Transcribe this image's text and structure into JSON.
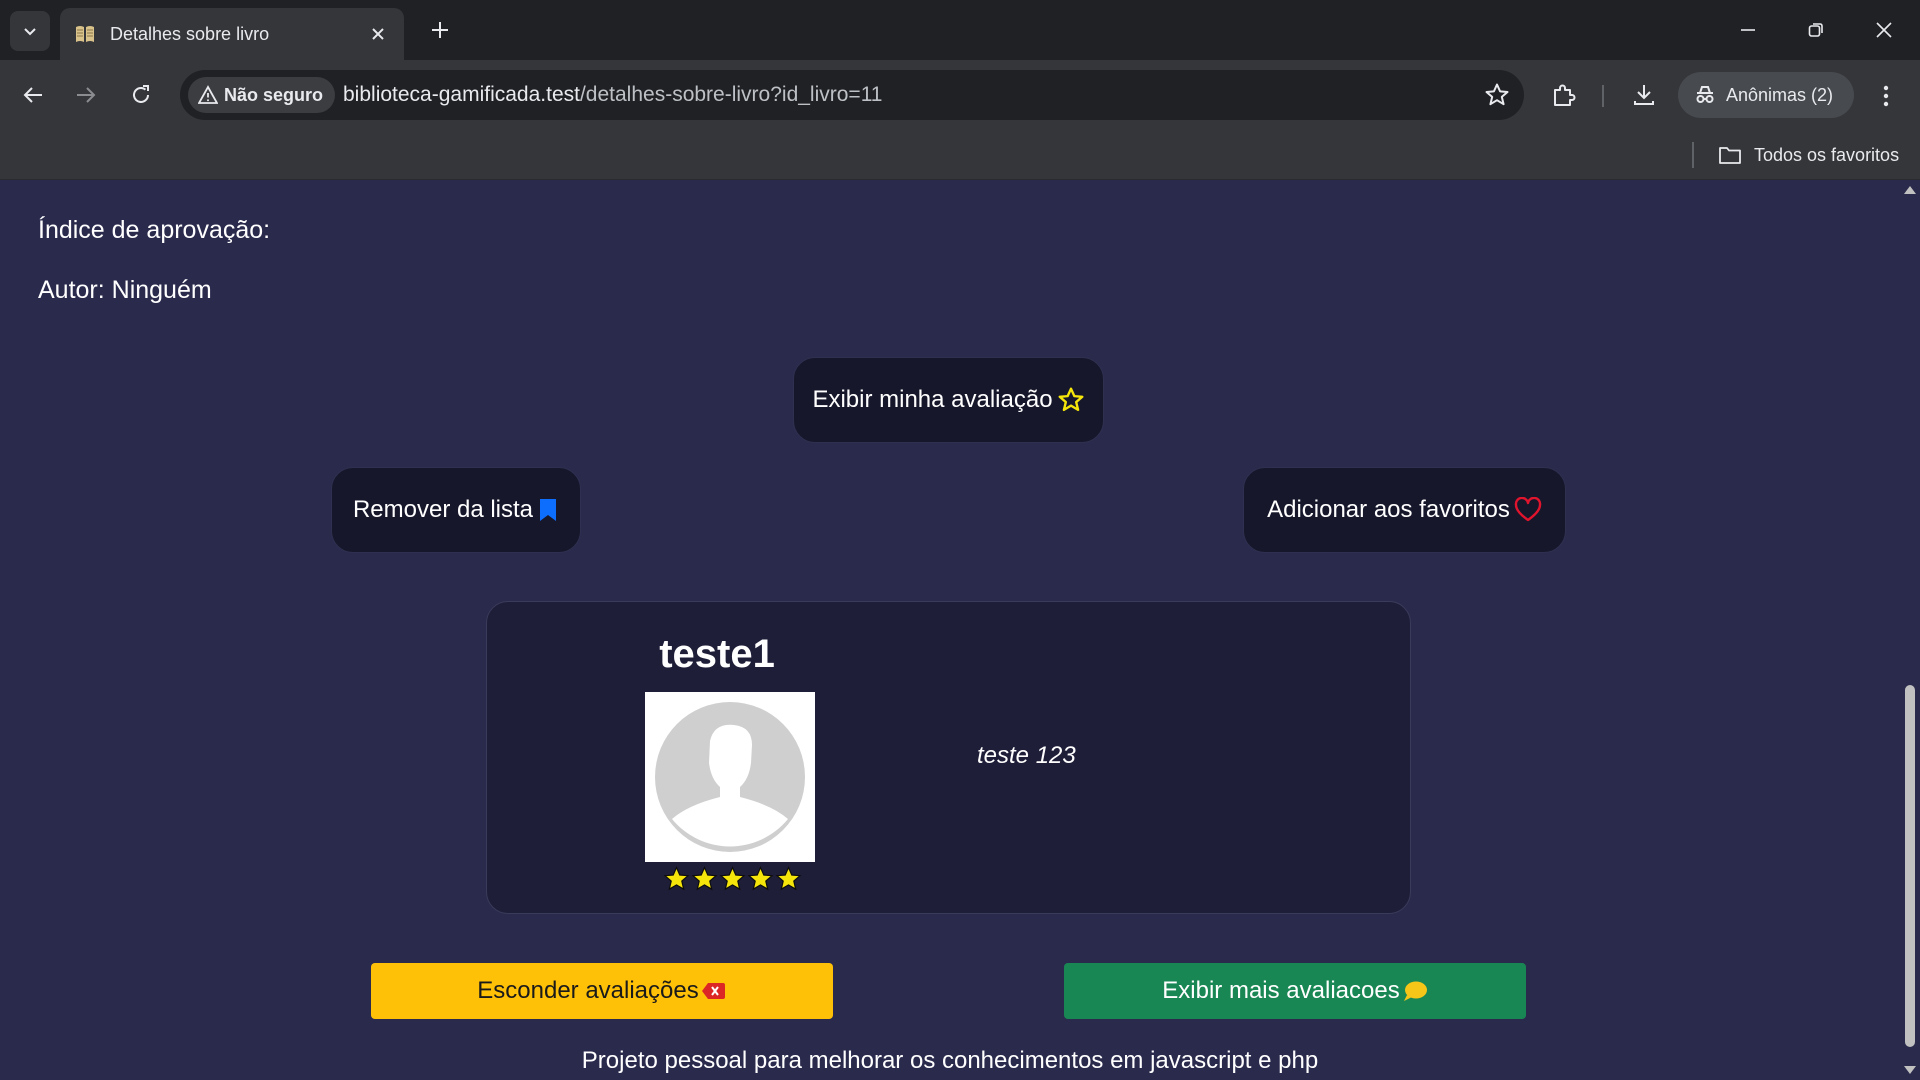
{
  "browser": {
    "tab_title": "Detalhes sobre livro",
    "security_label": "Não seguro",
    "url_host": "biblioteca-gamificada.test",
    "url_path": "/detalhes-sobre-livro?id_livro=11",
    "profile_label": "Anônimas (2)",
    "bookmarks_all_label": "Todos os favoritos"
  },
  "book": {
    "approval_label": "Índice de aprovação:",
    "author_label": "Autor: Ninguém"
  },
  "actions": {
    "show_my_review": "Exibir minha avaliação",
    "remove_from_list": "Remover da lista",
    "add_to_favorites": "Adicionar aos favoritos"
  },
  "review": {
    "username": "teste1",
    "text": "teste 123",
    "stars": 5,
    "max_stars": 5
  },
  "buttons": {
    "hide_reviews": "Esconder avaliações",
    "show_more_reviews": "Exibir mais avaliacoes"
  },
  "footer": {
    "text": "Projeto pessoal para melhorar os conhecimentos em javascript e php"
  },
  "colors": {
    "page_bg": "#2a2a4d",
    "star_yellow": "#f5e50a",
    "bookmark_blue": "#0d6efd",
    "heart_red": "#e0142d",
    "hide_btn": "#ffc107",
    "more_btn": "#198754"
  },
  "icons": [
    "tab-list-icon",
    "book-favicon-icon",
    "close-icon",
    "plus-icon",
    "minimize-icon",
    "restore-icon",
    "window-close-icon",
    "back-icon",
    "forward-icon",
    "reload-icon",
    "warning-icon",
    "bookmark-star-icon",
    "extensions-icon",
    "download-icon",
    "incognito-icon",
    "more-icon",
    "folder-icon",
    "star-outline-icon",
    "bookmark-icon",
    "heart-icon",
    "x-square-icon",
    "chat-bubble-icon"
  ]
}
